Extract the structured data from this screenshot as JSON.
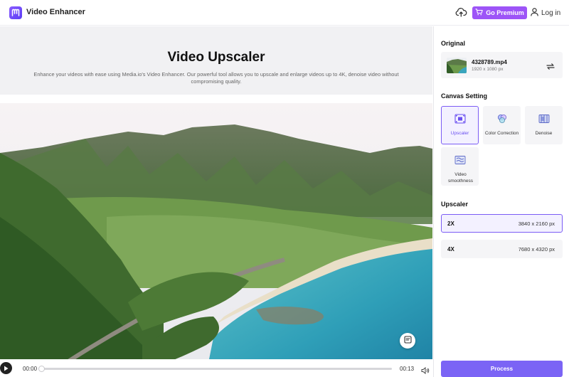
{
  "header": {
    "app_title": "Video Enhancer",
    "premium_label": "Go Premium",
    "login_label": "Log in"
  },
  "intro": {
    "title": "Video Upscaler",
    "description": "Enhance your videos with ease using Media.io's Video Enhancer. Our powerful tool allows you to upscale and enlarge videos up to 4K, denoise video without compromising quality."
  },
  "player": {
    "current_time": "00:00",
    "total_time": "00:13",
    "progress": 0.0
  },
  "panel": {
    "original_title": "Original",
    "file": {
      "name": "4328789.mp4",
      "resolution": "1920 x 1080 px"
    },
    "canvas_title": "Canvas Setting",
    "tools": [
      {
        "label": "Upscaler",
        "icon": "upscale-icon",
        "active": true
      },
      {
        "label": "Color Correction",
        "icon": "color-correction-icon",
        "active": false
      },
      {
        "label": "Denoise",
        "icon": "denoise-icon",
        "active": false
      },
      {
        "label": "Video smoothness",
        "icon": "smoothness-icon",
        "active": false
      }
    ],
    "upscaler_title": "Upscaler",
    "options": [
      {
        "label": "2X",
        "size": "3840 x 2160 px",
        "active": true
      },
      {
        "label": "4X",
        "size": "7680 x 4320 px",
        "active": false
      }
    ],
    "process_label": "Process"
  },
  "colors": {
    "accent": "#7b64f5",
    "premium": "#9d54f7",
    "active_border": "#7b5cf5"
  }
}
